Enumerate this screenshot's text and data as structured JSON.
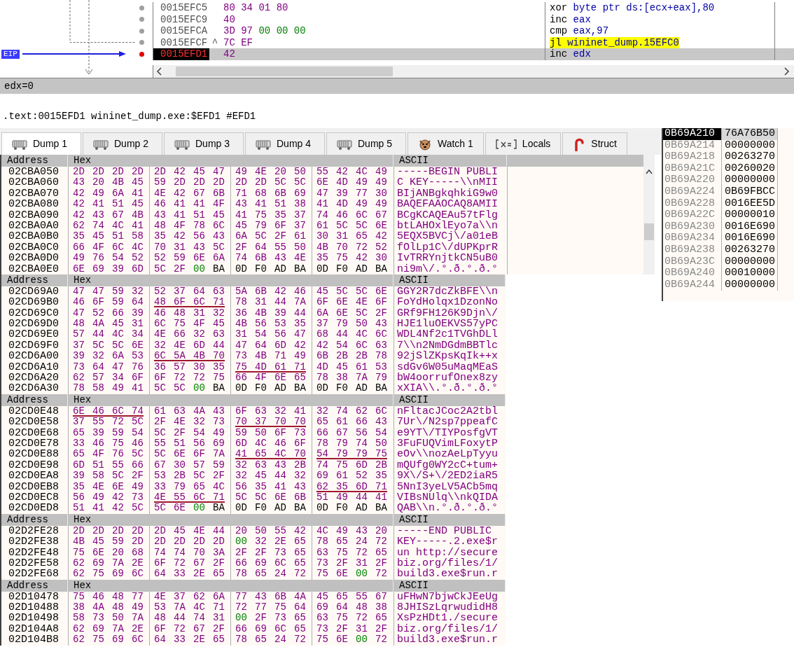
{
  "disassembly": {
    "eip_label": "EIP",
    "rows": [
      {
        "address": "0015EFC5",
        "jump_mark": "",
        "bytes": "80 34 01 80",
        "instruction": "xor byte ptr ds:[ecx+eax],80",
        "highlight": false,
        "current": false
      },
      {
        "address": "0015EFC9",
        "jump_mark": "",
        "bytes": "40",
        "instruction": "inc eax",
        "highlight": false,
        "current": false
      },
      {
        "address": "0015EFCA",
        "jump_mark": "",
        "bytes": "3D 97 00 00 00",
        "instruction": "cmp eax,97",
        "highlight": false,
        "current": false
      },
      {
        "address": "0015EFCF",
        "jump_mark": "^",
        "bytes": "7C EF",
        "instruction": "jl wininet_dump.15EFC0",
        "highlight": true,
        "current": false
      },
      {
        "address": "0015EFD1",
        "jump_mark": "",
        "bytes": "42",
        "instruction": "inc edx",
        "highlight": false,
        "current": true
      }
    ]
  },
  "register_info": "edx=0",
  "location_info": ".text:0015EFD1 wininet_dump.exe:$EFD1 #EFD1",
  "tabs": [
    {
      "label": "Dump 1",
      "kind": "dump",
      "selected": true
    },
    {
      "label": "Dump 2",
      "kind": "dump",
      "selected": false
    },
    {
      "label": "Dump 3",
      "kind": "dump",
      "selected": false
    },
    {
      "label": "Dump 4",
      "kind": "dump",
      "selected": false
    },
    {
      "label": "Dump 5",
      "kind": "dump",
      "selected": false
    },
    {
      "label": "Watch 1",
      "kind": "watch",
      "selected": false
    },
    {
      "label": "Locals",
      "kind": "locals",
      "selected": false
    },
    {
      "label": "Struct",
      "kind": "struct",
      "selected": false
    }
  ],
  "dump_panels": [
    {
      "columns": [
        "Address",
        "Hex",
        "ASCII"
      ],
      "rows": [
        {
          "address": "02CBA050",
          "hex": "2D 2D 2D 2D 2D 42 45 47 49 4E 20 50 55 42 4C 49",
          "ascii": "-----BEGIN PUBLI",
          "underlined": [
            false,
            false,
            false,
            false
          ]
        },
        {
          "address": "02CBA060",
          "hex": "43 20 4B 45 59 2D 2D 2D 2D 2D 5C 5C 6E 4D 49 49",
          "ascii": "C KEY-----\\\\nMII",
          "underlined": [
            false,
            false,
            false,
            false
          ]
        },
        {
          "address": "02CBA070",
          "hex": "42 49 6A 41 4E 42 67 6B 71 68 6B 69 47 39 77 30",
          "ascii": "BIjANBgkqhkiG9w0",
          "underlined": [
            false,
            false,
            false,
            false
          ]
        },
        {
          "address": "02CBA080",
          "hex": "42 41 51 45 46 41 41 4F 43 41 51 38 41 4D 49 49",
          "ascii": "BAQEFAAOCAQ8AMII",
          "underlined": [
            false,
            false,
            false,
            false
          ]
        },
        {
          "address": "02CBA090",
          "hex": "42 43 67 4B 43 41 51 45 41 75 35 37 74 46 6C 67",
          "ascii": "BCgKCAQEAu57tFlg",
          "underlined": [
            false,
            false,
            false,
            false
          ]
        },
        {
          "address": "02CBA0A0",
          "hex": "62 74 4C 41 48 4F 78 6C 45 79 6F 37 61 5C 5C 6E",
          "ascii": "btLAHOxlEyo7a\\\\n",
          "underlined": [
            false,
            false,
            false,
            false
          ]
        },
        {
          "address": "02CBA0B0",
          "hex": "35 45 51 58 35 42 56 43 6A 5C 2F 61 30 31 65 42",
          "ascii": "5EQX5BVCj\\/a01eB",
          "underlined": [
            false,
            false,
            false,
            false
          ]
        },
        {
          "address": "02CBA0C0",
          "hex": "66 4F 6C 4C 70 31 43 5C 2F 64 55 50 4B 70 72 52",
          "ascii": "fOlLp1C\\/dUPKprR",
          "underlined": [
            false,
            false,
            false,
            false
          ]
        },
        {
          "address": "02CBA0D0",
          "hex": "49 76 54 52 52 59 6E 6A 74 6B 43 4E 35 75 42 30",
          "ascii": "IvTRRYnjtkCN5uB0",
          "underlined": [
            false,
            false,
            false,
            false
          ]
        },
        {
          "address": "02CBA0E0",
          "hex": "6E 69 39 6D 5C 2F 00 BA 0D F0 AD BA 0D F0 AD BA",
          "ascii": "ni9m\\/.°.ð.°.ð.°",
          "underlined": [
            false,
            false,
            false,
            false
          ]
        }
      ]
    },
    {
      "columns": [
        "Address",
        "Hex",
        "ASCII"
      ],
      "rows": [
        {
          "address": "02CD69A0",
          "hex": "47 47 59 32 52 37 64 63 5A 6B 42 46 45 5C 5C 6E",
          "ascii": "GGY2R7dcZkBFE\\\\n",
          "underlined": [
            false,
            false,
            false,
            false
          ]
        },
        {
          "address": "02CD69B0",
          "hex": "46 6F 59 64 48 6F 6C 71 78 31 44 7A 6F 6E 4E 6F",
          "ascii": "FoYdHolqx1DzonNo",
          "underlined": [
            false,
            true,
            false,
            false
          ]
        },
        {
          "address": "02CD69C0",
          "hex": "47 52 66 39 46 48 31 32 36 4B 39 44 6A 6E 5C 2F",
          "ascii": "GRf9FH126K9Djn\\/",
          "underlined": [
            false,
            false,
            false,
            false
          ]
        },
        {
          "address": "02CD69D0",
          "hex": "48 4A 45 31 6C 75 4F 45 4B 56 53 35 37 79 50 43",
          "ascii": "HJE1luOEKVS57yPC",
          "underlined": [
            false,
            false,
            false,
            false
          ]
        },
        {
          "address": "02CD69E0",
          "hex": "57 44 4C 34 4E 66 32 63 31 54 56 47 68 44 4C 6C",
          "ascii": "WDL4Nf2c1TVGhDLl",
          "underlined": [
            false,
            false,
            false,
            false
          ]
        },
        {
          "address": "02CD69F0",
          "hex": "37 5C 5C 6E 32 4E 6D 44 47 64 6D 42 42 54 6C 63",
          "ascii": "7\\\\n2NmDGdmBBTlc",
          "underlined": [
            false,
            false,
            false,
            false
          ]
        },
        {
          "address": "02CD6A00",
          "hex": "39 32 6A 53 6C 5A 4B 70 73 4B 71 49 6B 2B 2B 78",
          "ascii": "92jSlZKpsKqIk++x",
          "underlined": [
            false,
            true,
            false,
            false
          ]
        },
        {
          "address": "02CD6A10",
          "hex": "73 64 47 76 36 57 30 35 75 4D 61 71 4D 45 61 53",
          "ascii": "sdGv6W05uMaqMEaS",
          "underlined": [
            false,
            false,
            true,
            false
          ]
        },
        {
          "address": "02CD6A20",
          "hex": "62 57 34 6F 6F 72 72 75 66 4F 6E 65 78 38 7A 79",
          "ascii": "bW4oorrufOnex8zy",
          "underlined": [
            false,
            false,
            false,
            false
          ]
        },
        {
          "address": "02CD6A30",
          "hex": "78 58 49 41 5C 5C 00 BA 0D F0 AD BA 0D F0 AD BA",
          "ascii": "xXIA\\\\.°.ð.°.ð.°",
          "underlined": [
            false,
            false,
            false,
            false
          ]
        }
      ]
    },
    {
      "columns": [
        "Address",
        "Hex",
        "ASCII"
      ],
      "rows": [
        {
          "address": "02CD0E48",
          "hex": "6E 46 6C 74 61 63 4A 43 6F 63 32 41 32 74 62 6C",
          "ascii": "nFltacJCoc2A2tbl",
          "underlined": [
            true,
            false,
            false,
            false
          ]
        },
        {
          "address": "02CD0E58",
          "hex": "37 55 72 5C 2F 4E 32 73 70 37 70 70 65 61 66 43",
          "ascii": "7Ur\\/N2sp7ppeafC",
          "underlined": [
            false,
            false,
            true,
            false
          ]
        },
        {
          "address": "02CD0E68",
          "hex": "65 39 59 54 5C 2F 54 49 59 50 6F 73 66 67 56 54",
          "ascii": "e9YT\\/TIYPosfgVT",
          "underlined": [
            false,
            false,
            false,
            false
          ]
        },
        {
          "address": "02CD0E78",
          "hex": "33 46 75 46 55 51 56 69 6D 4C 46 6F 78 79 74 50",
          "ascii": "3FuFUQVimLFoxytP",
          "underlined": [
            false,
            false,
            false,
            false
          ]
        },
        {
          "address": "02CD0E88",
          "hex": "65 4F 76 5C 5C 6E 6F 7A 41 65 4C 70 54 79 79 75",
          "ascii": "eOv\\\\nozAeLpTyyu",
          "underlined": [
            false,
            false,
            true,
            true
          ]
        },
        {
          "address": "02CD0E98",
          "hex": "6D 51 55 66 67 30 57 59 32 63 43 2B 74 75 6D 2B",
          "ascii": "mQUfg0WY2cC+tum+",
          "underlined": [
            false,
            false,
            false,
            false
          ]
        },
        {
          "address": "02CD0EA8",
          "hex": "39 58 5C 2F 53 2B 5C 2F 32 45 44 32 69 61 52 35",
          "ascii": "9X\\/S+\\/2ED2iaR5",
          "underlined": [
            false,
            false,
            false,
            false
          ]
        },
        {
          "address": "02CD0EB8",
          "hex": "35 4E 6E 49 33 79 65 4C 56 35 41 43 62 35 6D 71",
          "ascii": "5NnI3yeLV5ACb5mq",
          "underlined": [
            false,
            false,
            false,
            true
          ]
        },
        {
          "address": "02CD0EC8",
          "hex": "56 49 42 73 4E 55 6C 71 5C 5C 6E 6B 51 49 44 41",
          "ascii": "VIBsNUlq\\\\nkQIDA",
          "underlined": [
            false,
            true,
            false,
            false
          ]
        },
        {
          "address": "02CD0ED8",
          "hex": "51 41 42 5C 5C 6E 00 BA 0D F0 AD BA 0D F0 AD BA",
          "ascii": "QAB\\\\n.°.ð.°.ð.°",
          "underlined": [
            false,
            false,
            false,
            false
          ]
        }
      ]
    },
    {
      "columns": [
        "Address",
        "Hex",
        "ASCII"
      ],
      "rows": [
        {
          "address": "02D2FE28",
          "hex": "2D 2D 2D 2D 2D 45 4E 44 20 50 55 42 4C 49 43 20",
          "ascii": "-----END PUBLIC",
          "underlined": [
            false,
            false,
            false,
            false
          ]
        },
        {
          "address": "02D2FE38",
          "hex": "4B 45 59 2D 2D 2D 2D 2D 00 32 2E 65 78 65 24 72",
          "ascii": "KEY-----.2.exe$r",
          "underlined": [
            false,
            false,
            false,
            false
          ]
        },
        {
          "address": "02D2FE48",
          "hex": "75 6E 20 68 74 74 70 3A 2F 2F 73 65 63 75 72 65",
          "ascii": "un http://secure",
          "underlined": [
            false,
            false,
            false,
            false
          ]
        },
        {
          "address": "02D2FE58",
          "hex": "62 69 7A 2E 6F 72 67 2F 66 69 6C 65 73 2F 31 2F",
          "ascii": "biz.org/files/1/",
          "underlined": [
            false,
            false,
            false,
            false
          ]
        },
        {
          "address": "02D2FE68",
          "hex": "62 75 69 6C 64 33 2E 65 78 65 24 72 75 6E 00 72",
          "ascii": "build3.exe$run.r",
          "underlined": [
            false,
            false,
            false,
            false
          ]
        }
      ]
    },
    {
      "columns": [
        "Address",
        "Hex",
        "ASCII"
      ],
      "rows": [
        {
          "address": "02D10478",
          "hex": "75 46 48 77 4E 37 62 6A 77 43 6B 4A 45 65 55 67",
          "ascii": "uFHwN7bjwCkJEeUg",
          "underlined": [
            false,
            false,
            false,
            false
          ]
        },
        {
          "address": "02D10488",
          "hex": "38 4A 48 49 53 7A 4C 71 72 77 75 64 69 64 48 38",
          "ascii": "8JHISzLqrwudidH8",
          "underlined": [
            false,
            false,
            false,
            false
          ]
        },
        {
          "address": "02D10498",
          "hex": "58 73 50 7A 48 44 74 31 00 2F 73 65 63 75 72 65",
          "ascii": "XsPzHDt1./secure",
          "underlined": [
            false,
            false,
            false,
            false
          ]
        },
        {
          "address": "02D104A8",
          "hex": "62 69 7A 2E 6F 72 67 2F 66 69 6C 65 73 2F 31 2F",
          "ascii": "biz.org/files/1/",
          "underlined": [
            false,
            false,
            false,
            false
          ]
        },
        {
          "address": "02D104B8",
          "hex": "62 75 69 6C 64 33 2E 65 78 65 24 72 75 6E 00 72",
          "ascii": "build3.exe$run.r",
          "underlined": [
            false,
            false,
            false,
            false
          ]
        }
      ]
    }
  ],
  "stack": {
    "rows": [
      {
        "address": "0B69A210",
        "value": "76A76B50",
        "selected": true
      },
      {
        "address": "0B69A214",
        "value": "00000000",
        "selected": false
      },
      {
        "address": "0B69A218",
        "value": "00263270",
        "selected": false
      },
      {
        "address": "0B69A21C",
        "value": "00260020",
        "selected": false
      },
      {
        "address": "0B69A220",
        "value": "00000000",
        "selected": false
      },
      {
        "address": "0B69A224",
        "value": "0B69FBCC",
        "selected": false
      },
      {
        "address": "0B69A228",
        "value": "0016EE5D",
        "selected": false
      },
      {
        "address": "0B69A22C",
        "value": "00000010",
        "selected": false
      },
      {
        "address": "0B69A230",
        "value": "0016E690",
        "selected": false
      },
      {
        "address": "0B69A234",
        "value": "0016E690",
        "selected": false
      },
      {
        "address": "0B69A238",
        "value": "00263270",
        "selected": false
      },
      {
        "address": "0B69A23C",
        "value": "00000000",
        "selected": false
      },
      {
        "address": "0B69A240",
        "value": "00010000",
        "selected": false
      },
      {
        "address": "0B69A244",
        "value": "00000000",
        "selected": false
      }
    ]
  }
}
